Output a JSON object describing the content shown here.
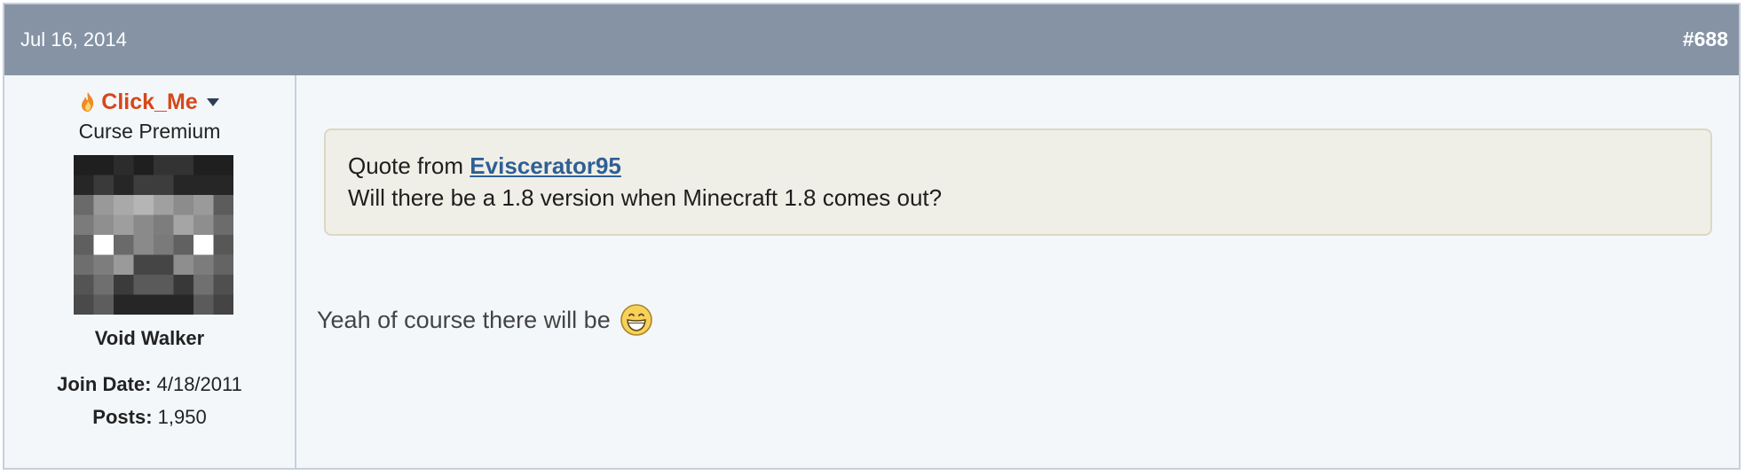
{
  "post": {
    "date": "Jul 16, 2014",
    "number": "#688"
  },
  "user": {
    "name": "Click_Me",
    "title": "Curse Premium",
    "rank": "Void Walker",
    "join_date_label": "Join Date:",
    "join_date": "4/18/2011",
    "posts_label": "Posts:",
    "posts": "1,950",
    "icons": {
      "badge": "flame-icon",
      "menu": "chevron-down-icon"
    },
    "name_color": "#d4481a"
  },
  "quote": {
    "prefix": "Quote from",
    "author": "Eviscerator95",
    "text": "Will there be a 1.8 version when Minecraft 1.8 comes out?"
  },
  "message": {
    "text": "Yeah of course there will be",
    "emoji": "grinning-smiley-icon"
  },
  "colors": {
    "header_bg": "#8593a5",
    "body_bg": "#f4f7fa",
    "quote_bg": "#f0efe7",
    "link": "#2f5f96"
  }
}
